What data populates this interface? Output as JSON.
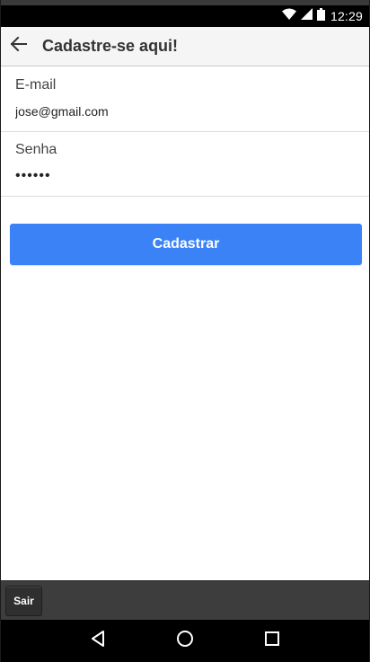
{
  "status_bar": {
    "time": "12:29",
    "icons": [
      "wifi-icon",
      "signal-icon",
      "battery-icon"
    ]
  },
  "app_bar": {
    "back_icon": "arrow-left-icon",
    "title": "Cadastre-se aqui!"
  },
  "form": {
    "email": {
      "label": "E-mail",
      "value": "jose@gmail.com"
    },
    "password": {
      "label": "Senha",
      "value": "••••••"
    },
    "submit_label": "Cadastrar"
  },
  "bottom_bar": {
    "exit_label": "Sair"
  },
  "nav_bar": {
    "icons": [
      "back-triangle-icon",
      "home-circle-icon",
      "recents-square-icon"
    ]
  },
  "colors": {
    "primary": "#3b82f6",
    "app_bar_bg": "#f5f5f5",
    "toolbar_bg": "#3d3d3d",
    "status_bg": "#000000"
  }
}
